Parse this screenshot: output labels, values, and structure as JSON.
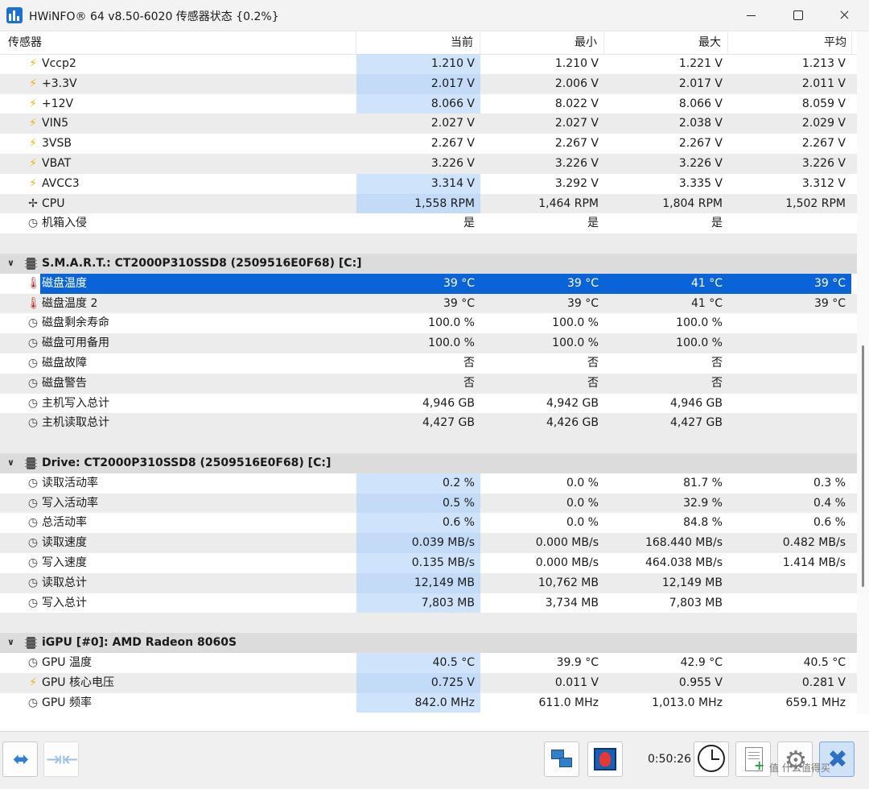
{
  "window": {
    "title": "HWiNFO® 64 v8.50-6020 传感器状态 {0.2%}"
  },
  "header": {
    "name": "传感器",
    "current": "当前",
    "min": "最小",
    "max": "最大",
    "avg": "平均"
  },
  "rows": [
    {
      "type": "sensor",
      "icon": "bolt-icon",
      "name": "Vccp2",
      "cur": "1.210 V",
      "min": "1.210 V",
      "max": "1.221 V",
      "avg": "1.213 V",
      "hl": true
    },
    {
      "type": "sensor",
      "icon": "bolt-icon",
      "name": "+3.3V",
      "cur": "2.017 V",
      "min": "2.006 V",
      "max": "2.017 V",
      "avg": "2.011 V",
      "hl": true
    },
    {
      "type": "sensor",
      "icon": "bolt-icon",
      "name": "+12V",
      "cur": "8.066 V",
      "min": "8.022 V",
      "max": "8.066 V",
      "avg": "8.059 V",
      "hl": true
    },
    {
      "type": "sensor",
      "icon": "bolt-icon",
      "name": "VIN5",
      "cur": "2.027 V",
      "min": "2.027 V",
      "max": "2.038 V",
      "avg": "2.029 V",
      "hl": false
    },
    {
      "type": "sensor",
      "icon": "bolt-icon",
      "name": "3VSB",
      "cur": "2.267 V",
      "min": "2.267 V",
      "max": "2.267 V",
      "avg": "2.267 V",
      "hl": false
    },
    {
      "type": "sensor",
      "icon": "bolt-icon",
      "name": "VBAT",
      "cur": "3.226 V",
      "min": "3.226 V",
      "max": "3.226 V",
      "avg": "3.226 V",
      "hl": false
    },
    {
      "type": "sensor",
      "icon": "bolt-icon",
      "name": "AVCC3",
      "cur": "3.314 V",
      "min": "3.292 V",
      "max": "3.335 V",
      "avg": "3.312 V",
      "hl": true
    },
    {
      "type": "sensor",
      "icon": "fan-icon",
      "name": "CPU",
      "cur": "1,558 RPM",
      "min": "1,464 RPM",
      "max": "1,804 RPM",
      "avg": "1,502 RPM",
      "hl": true
    },
    {
      "type": "sensor",
      "icon": "clock-icon",
      "name": "机箱入侵",
      "cur": "是",
      "min": "是",
      "max": "是",
      "avg": "",
      "hl": false
    },
    {
      "type": "blank"
    },
    {
      "type": "group",
      "name": "S.M.A.R.T.: CT2000P310SSD8 (2509516E0F68) [C:]"
    },
    {
      "type": "sensor",
      "icon": "thermometer-icon",
      "name": "磁盘温度",
      "cur": "39 °C",
      "min": "39 °C",
      "max": "41 °C",
      "avg": "39 °C",
      "hl": false,
      "selected": true
    },
    {
      "type": "sensor",
      "icon": "thermometer-icon",
      "name": "磁盘温度 2",
      "cur": "39 °C",
      "min": "39 °C",
      "max": "41 °C",
      "avg": "39 °C",
      "hl": false
    },
    {
      "type": "sensor",
      "icon": "clock-icon",
      "name": "磁盘剩余寿命",
      "cur": "100.0 %",
      "min": "100.0 %",
      "max": "100.0 %",
      "avg": "",
      "hl": false
    },
    {
      "type": "sensor",
      "icon": "clock-icon",
      "name": "磁盘可用备用",
      "cur": "100.0 %",
      "min": "100.0 %",
      "max": "100.0 %",
      "avg": "",
      "hl": false
    },
    {
      "type": "sensor",
      "icon": "clock-icon",
      "name": "磁盘故障",
      "cur": "否",
      "min": "否",
      "max": "否",
      "avg": "",
      "hl": false
    },
    {
      "type": "sensor",
      "icon": "clock-icon",
      "name": "磁盘警告",
      "cur": "否",
      "min": "否",
      "max": "否",
      "avg": "",
      "hl": false
    },
    {
      "type": "sensor",
      "icon": "clock-icon",
      "name": "主机写入总计",
      "cur": "4,946 GB",
      "min": "4,942 GB",
      "max": "4,946 GB",
      "avg": "",
      "hl": false
    },
    {
      "type": "sensor",
      "icon": "clock-icon",
      "name": "主机读取总计",
      "cur": "4,427 GB",
      "min": "4,426 GB",
      "max": "4,427 GB",
      "avg": "",
      "hl": false
    },
    {
      "type": "blank"
    },
    {
      "type": "group",
      "name": "Drive: CT2000P310SSD8 (2509516E0F68) [C:]"
    },
    {
      "type": "sensor",
      "icon": "clock-icon",
      "name": "读取活动率",
      "cur": "0.2 %",
      "min": "0.0 %",
      "max": "81.7 %",
      "avg": "0.3 %",
      "hl": true
    },
    {
      "type": "sensor",
      "icon": "clock-icon",
      "name": "写入活动率",
      "cur": "0.5 %",
      "min": "0.0 %",
      "max": "32.9 %",
      "avg": "0.4 %",
      "hl": true
    },
    {
      "type": "sensor",
      "icon": "clock-icon",
      "name": "总活动率",
      "cur": "0.6 %",
      "min": "0.0 %",
      "max": "84.8 %",
      "avg": "0.6 %",
      "hl": true
    },
    {
      "type": "sensor",
      "icon": "clock-icon",
      "name": "读取速度",
      "cur": "0.039 MB/s",
      "min": "0.000 MB/s",
      "max": "168.440 MB/s",
      "avg": "0.482 MB/s",
      "hl": true
    },
    {
      "type": "sensor",
      "icon": "clock-icon",
      "name": "写入速度",
      "cur": "0.135 MB/s",
      "min": "0.000 MB/s",
      "max": "464.038 MB/s",
      "avg": "1.414 MB/s",
      "hl": true
    },
    {
      "type": "sensor",
      "icon": "clock-icon",
      "name": "读取总计",
      "cur": "12,149 MB",
      "min": "10,762 MB",
      "max": "12,149 MB",
      "avg": "",
      "hl": true
    },
    {
      "type": "sensor",
      "icon": "clock-icon",
      "name": "写入总计",
      "cur": "7,803 MB",
      "min": "3,734 MB",
      "max": "7,803 MB",
      "avg": "",
      "hl": true
    },
    {
      "type": "blank"
    },
    {
      "type": "group",
      "name": "iGPU [#0]: AMD Radeon 8060S"
    },
    {
      "type": "sensor",
      "icon": "clock-icon",
      "name": "GPU 温度",
      "cur": "40.5 °C",
      "min": "39.9 °C",
      "max": "42.9 °C",
      "avg": "40.5 °C",
      "hl": true
    },
    {
      "type": "sensor",
      "icon": "bolt-icon",
      "name": "GPU 核心电压",
      "cur": "0.725 V",
      "min": "0.011 V",
      "max": "0.955 V",
      "avg": "0.281 V",
      "hl": true
    },
    {
      "type": "sensor",
      "icon": "clock-icon",
      "name": "GPU 频率",
      "cur": "842.0 MHz",
      "min": "611.0 MHz",
      "max": "1,013.0 MHz",
      "avg": "659.1 MHz",
      "hl": true
    }
  ],
  "toolbar": {
    "timer": "0:50:26"
  },
  "colors": {
    "selection": "#0a64d8",
    "highlight": "#cfe3fb",
    "group_bg": "#dcdcdc",
    "alt_row": "#ececec"
  },
  "watermark": "值 什么值得买"
}
